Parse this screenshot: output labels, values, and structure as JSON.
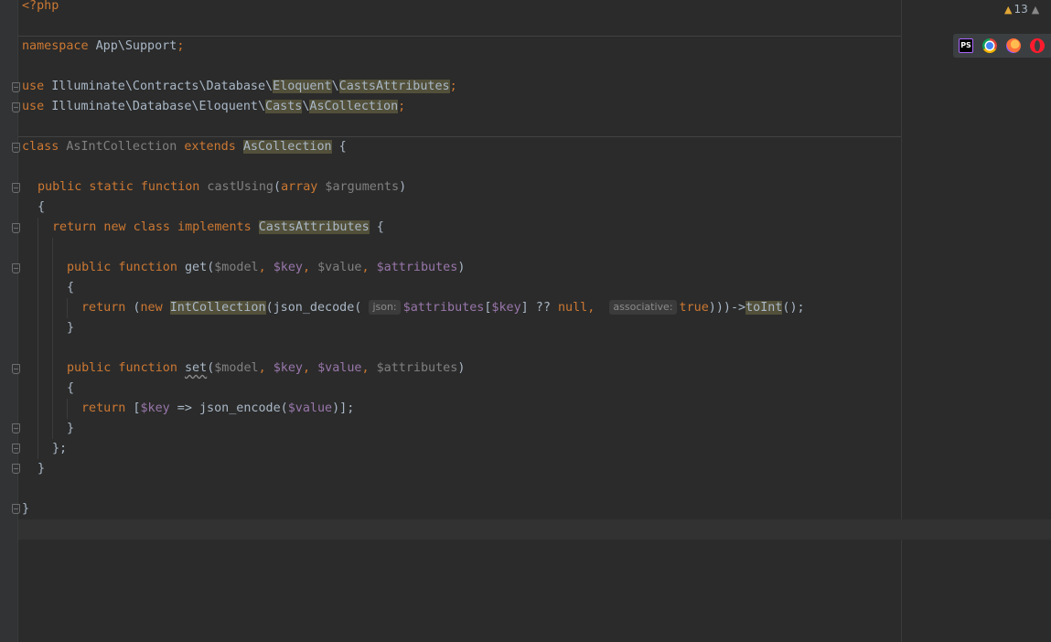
{
  "editor": {
    "lines": {
      "l1": "<?php",
      "ns_kw": "namespace",
      "ns_name": " App\\Support",
      "semi": ";",
      "use1_kw": "use",
      "use1_a": " Illuminate\\Contracts\\Database\\",
      "use1_b": "Eloquent",
      "use1_sep": "\\",
      "use1_c": "CastsAttributes",
      "use2_kw": "use",
      "use2_a": " Illuminate\\Database\\Eloquent\\",
      "use2_b": "Casts",
      "use2_sep": "\\",
      "use2_c": "AsCollection",
      "cls_kw": "class",
      "cls_name": " AsIntCollection ",
      "cls_ext": "extends",
      "cls_parent": "AsCollection",
      "cls_brace": " {",
      "m1_kw": "public static function",
      "m1_name": " castUsing",
      "m1_open": "(",
      "m1_type": "array",
      "m1_arg": " $arguments",
      "m1_close": ")",
      "open_brace": "{",
      "close_brace": "}",
      "ret_kw": "return new class implements",
      "ret_iface": "CastsAttributes",
      "ret_brace": " {",
      "get_kw": "public function",
      "get_name": " get",
      "get_p1": "$model",
      "get_p2": "$key",
      "get_p3": "$value",
      "get_p4": "$attributes",
      "ret2_kw": "return",
      "ret2_new": "new",
      "ret2_cls": "IntCollection",
      "ret2_fn": "json_decode(",
      "hint_json": "json:",
      "ret2_attrs": "$attributes",
      "ret2_key": "$key",
      "ret2_mid": "] ?? ",
      "ret2_null": "null",
      "hint_assoc": "associative:",
      "ret2_true": "true",
      "ret2_arrow": ")))->",
      "ret2_toint": "toInt",
      "ret2_end": "();",
      "set_kw": "public function",
      "set_name": "set",
      "set_p1": "$model",
      "set_p2": "$key",
      "set_p3": "$value",
      "set_p4": "$attributes",
      "ret3_kw": "return",
      "ret3_open": " [",
      "ret3_key": "$key",
      "ret3_arrow": " => json_encode(",
      "ret3_val": "$value",
      "ret3_end": ")];",
      "end_anon": "};",
      "end_brace": "}"
    }
  },
  "inspections": {
    "warning_count": "13"
  },
  "browsers": [
    "phpstorm-icon",
    "chrome-icon",
    "firefox-icon",
    "opera-icon"
  ]
}
